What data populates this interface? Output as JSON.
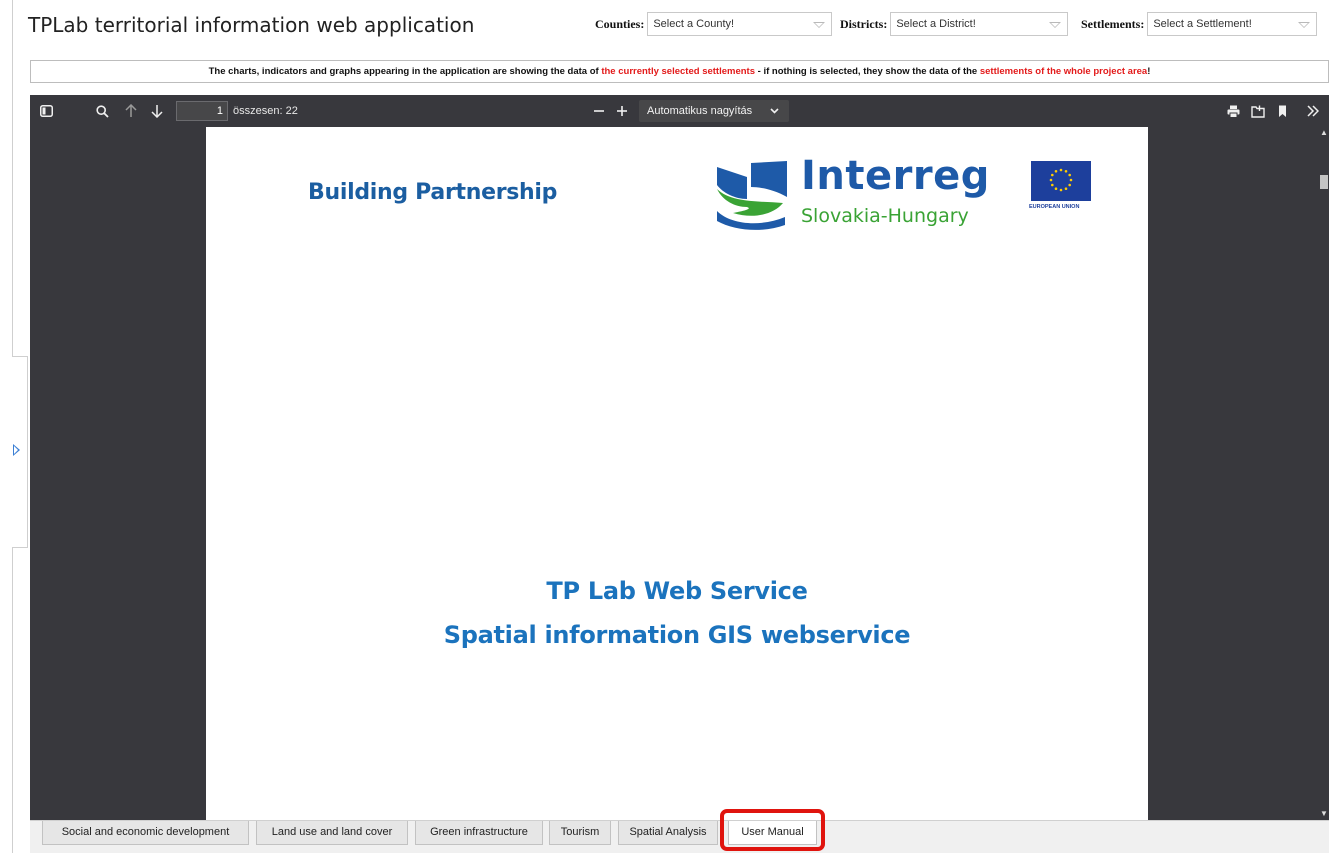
{
  "app": {
    "title": "TPLab territorial information web application"
  },
  "filters": {
    "counties": {
      "label": "Counties:",
      "value": "Select a County!"
    },
    "districts": {
      "label": "Districts:",
      "value": "Select a District!"
    },
    "settlements": {
      "label": "Settlements:",
      "value": "Select a Settlement!"
    }
  },
  "notice": {
    "part1": "The charts, indicators and graphs appearing in the application are showing the data of ",
    "red1": "the currently selected settlements",
    "part2": " - if nothing is selected, they show the data of the ",
    "red2": "settlements of the whole project area",
    "part3": "!"
  },
  "pdf_viewer": {
    "page_number": "1",
    "page_total": "összesen: 22",
    "zoom_label": "Automatikus nagyítás",
    "document": {
      "heading": "Building Partnership",
      "logo_text": "Interreg",
      "logo_subtext": "Slovakia-Hungary",
      "eu_label": "EUROPEAN UNION",
      "title_line1": "TP Lab Web Service",
      "title_line2": "Spatial information GIS webservice"
    }
  },
  "tabs": [
    {
      "label": "Social and economic development"
    },
    {
      "label": "Land use and land cover"
    },
    {
      "label": "Green infrastructure"
    },
    {
      "label": "Tourism"
    },
    {
      "label": "Spatial Analysis"
    },
    {
      "label": "User Manual",
      "active": true
    }
  ],
  "colors": {
    "highlight": "#e0140e",
    "viewer_bg": "#38383d",
    "doc_blue": "#1b73bd",
    "notice_red": "#e31b1b"
  }
}
